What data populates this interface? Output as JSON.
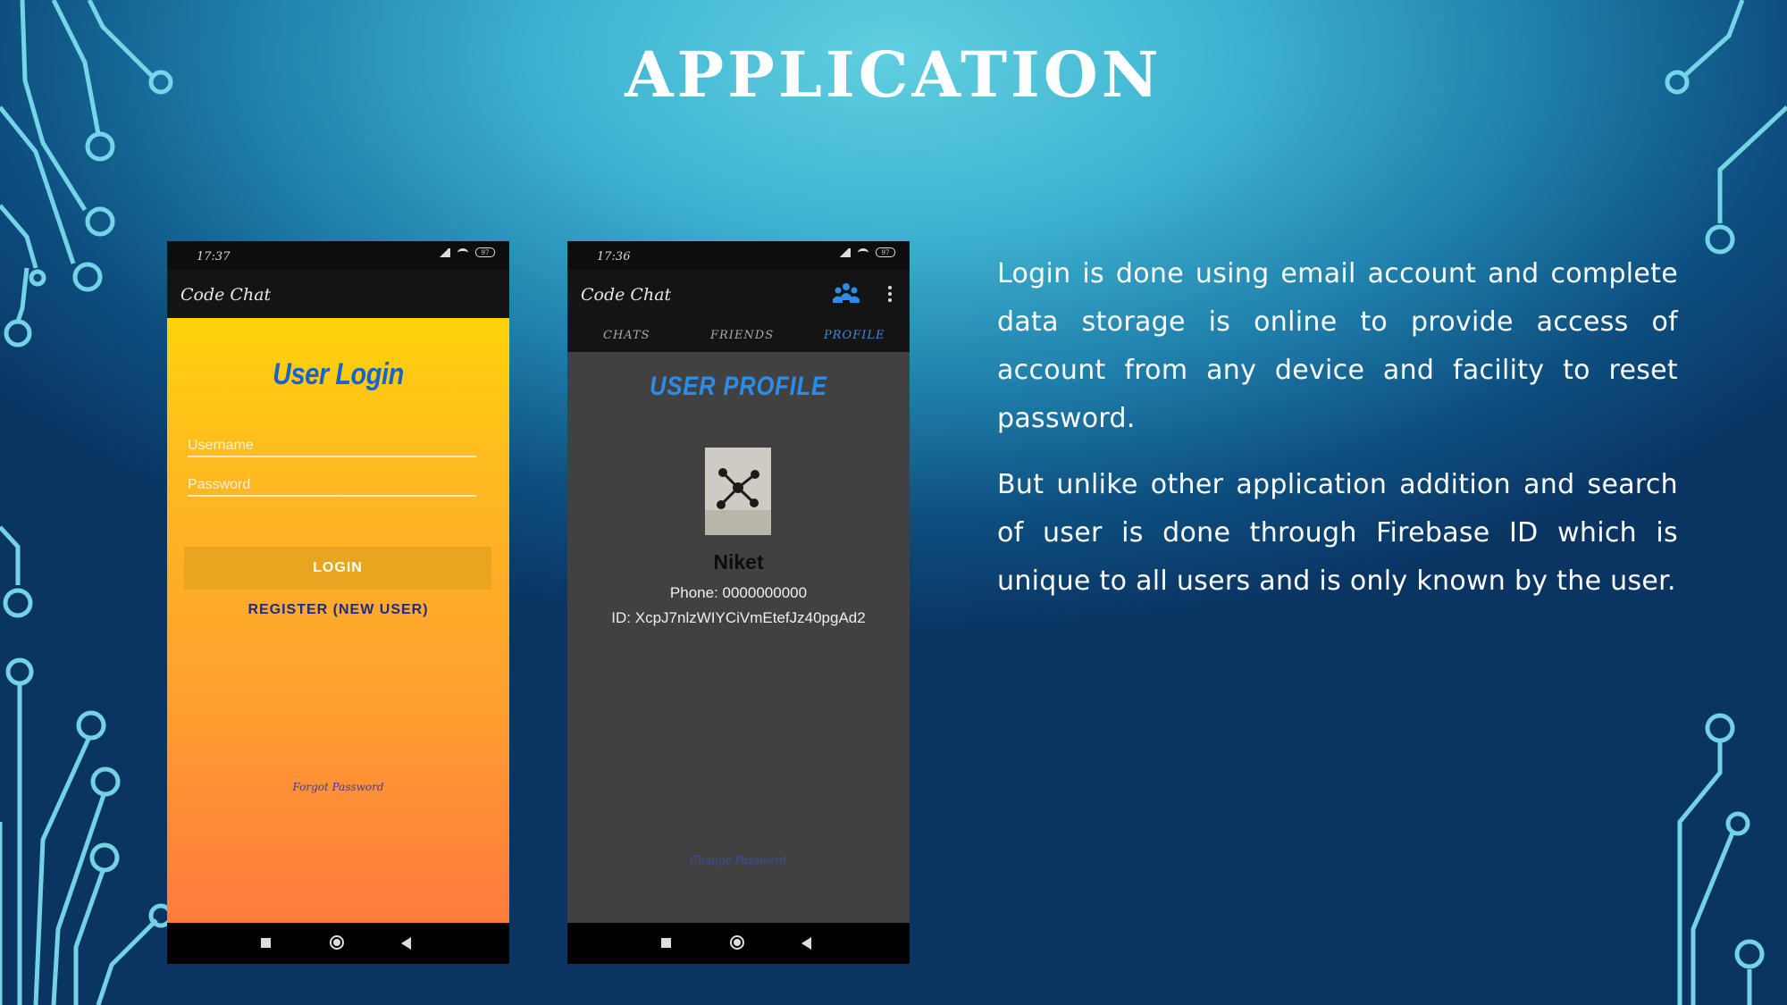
{
  "slide": {
    "title": "APPLICATION",
    "paragraphs": [
      "Login is done using email account and complete data storage is online to provide access of account from any device and facility to reset password.",
      "But unlike other application addition and search of user is done through Firebase ID which is unique to all users and is only known by the user."
    ]
  },
  "login_screen": {
    "time": "17:37",
    "battery": "97",
    "app_title": "Code Chat",
    "heading": "User Login",
    "username_placeholder": "Username",
    "password_placeholder": "Password",
    "login_label": "LOGIN",
    "register_label": "REGISTER (NEW USER)",
    "forgot_label": "Forgot Password"
  },
  "profile_screen": {
    "time": "17:36",
    "battery": "97",
    "app_title": "Code Chat",
    "tabs": [
      "CHATS",
      "FRIENDS",
      "PROFILE"
    ],
    "active_tab": "PROFILE",
    "heading": "USER PROFILE",
    "name": "Niket",
    "phone": "Phone: 0000000000",
    "id": "ID: XcpJ7nlzWIYCiVmEtefJz40pgAd2",
    "change_password_label": "Change Password"
  },
  "colors": {
    "accent_blue": "#2c8de8",
    "login_gradient_top": "#ffd30a",
    "login_gradient_bottom": "#ff7a3e",
    "profile_bg": "#414141"
  }
}
